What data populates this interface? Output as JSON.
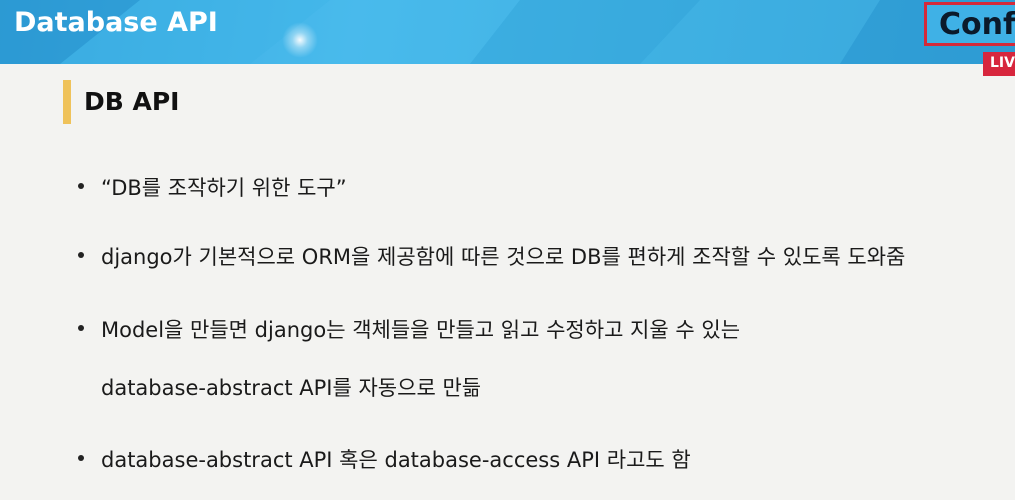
{
  "header": {
    "title": "Database API",
    "conf_label": "Conf",
    "live_label": "LIV"
  },
  "section": {
    "title": "DB API"
  },
  "bullets": [
    {
      "text": "“DB를 조작하기 위한 도구”"
    },
    {
      "text": "django가 기본적으로 ORM을 제공함에 따른 것으로 DB를 편하게 조작할 수 있도록 도와줌"
    },
    {
      "text": "Model을 만들면 django는 객체들을 만들고 읽고 수정하고 지울 수 있는",
      "continuation": "database-abstract API를 자동으로 만듦"
    },
    {
      "text": "database-abstract API 혹은 database-access API 라고도 함"
    }
  ],
  "colors": {
    "header_blue": "#39acdf",
    "accent_yellow": "#efc25a",
    "live_red": "#d7263d",
    "background": "#f3f3f1"
  }
}
